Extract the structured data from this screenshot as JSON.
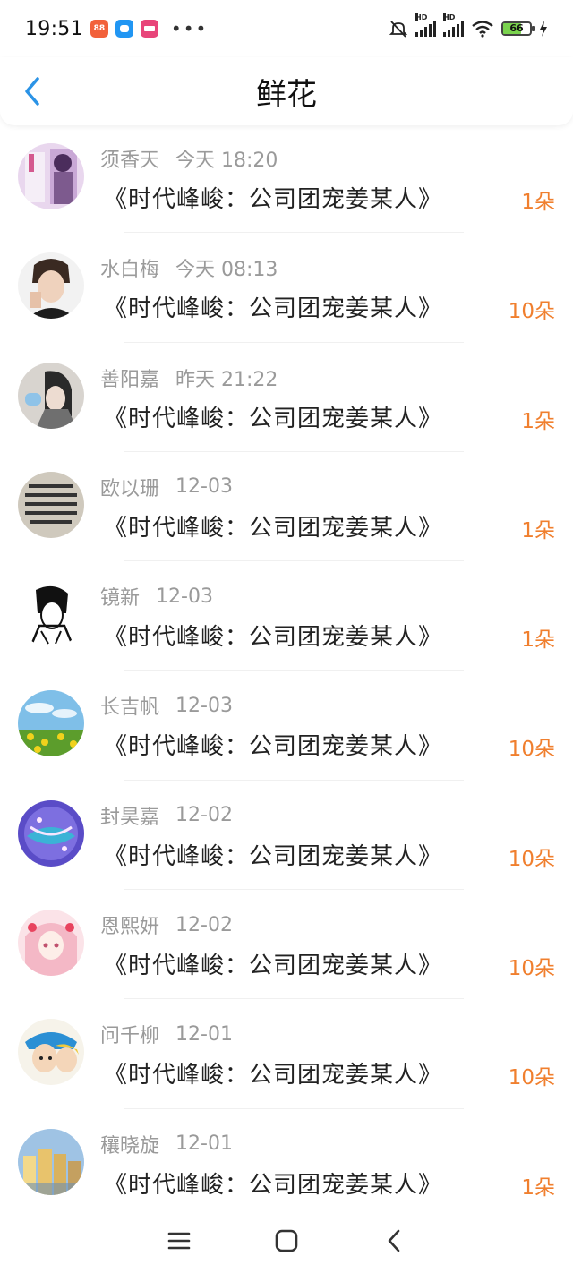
{
  "status_bar": {
    "time": "19:51",
    "battery_level": "66",
    "network_labels": [
      "HD",
      "HD"
    ],
    "app_icons": [
      {
        "name": "shopping-app-icon",
        "color": "#f2613a",
        "label": "88"
      },
      {
        "name": "chat-app-icon",
        "color": "#2196f3",
        "label": ""
      },
      {
        "name": "reader-app-icon",
        "color": "#e8457a",
        "label": ""
      }
    ]
  },
  "header": {
    "title": "鲜花"
  },
  "accent_color": "#2b93e6",
  "count_color": "#f07f2e",
  "items": [
    {
      "user": "须香天",
      "time": "今天 18:20",
      "book": "《时代峰峻：公司团宠姜某人》",
      "count": "1朵"
    },
    {
      "user": "水白梅",
      "time": "今天 08:13",
      "book": "《时代峰峻：公司团宠姜某人》",
      "count": "10朵"
    },
    {
      "user": "善阳嘉",
      "time": "昨天 21:22",
      "book": "《时代峰峻：公司团宠姜某人》",
      "count": "1朵"
    },
    {
      "user": "欧以珊",
      "time": "12-03",
      "book": "《时代峰峻：公司团宠姜某人》",
      "count": "1朵"
    },
    {
      "user": "镜新",
      "time": "12-03",
      "book": "《时代峰峻：公司团宠姜某人》",
      "count": "1朵"
    },
    {
      "user": "长吉帆",
      "time": "12-03",
      "book": "《时代峰峻：公司团宠姜某人》",
      "count": "10朵"
    },
    {
      "user": "封昊嘉",
      "time": "12-02",
      "book": "《时代峰峻：公司团宠姜某人》",
      "count": "10朵"
    },
    {
      "user": "恩熙妍",
      "time": "12-02",
      "book": "《时代峰峻：公司团宠姜某人》",
      "count": "10朵"
    },
    {
      "user": "问千柳",
      "time": "12-01",
      "book": "《时代峰峻：公司团宠姜某人》",
      "count": "10朵"
    },
    {
      "user": "穰晓旋",
      "time": "12-01",
      "book": "《时代峰峻：公司团宠姜某人》",
      "count": "1朵"
    }
  ]
}
